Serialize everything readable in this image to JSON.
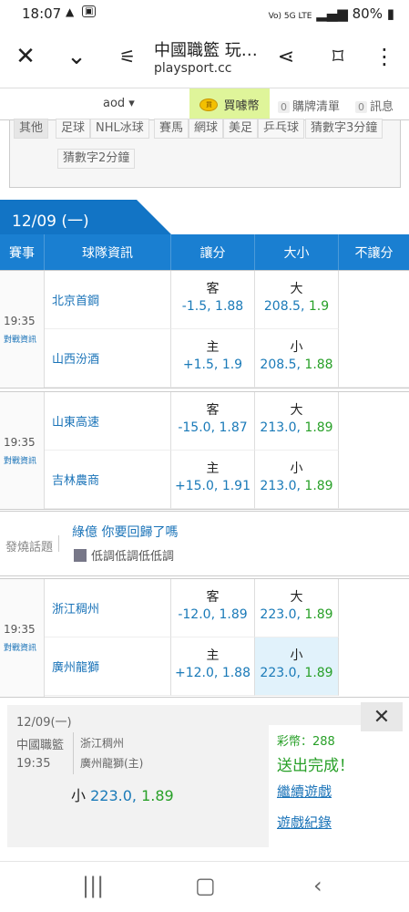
{
  "status": {
    "time": "18:07",
    "network": "Vo) 5G LTE",
    "battery": "80%"
  },
  "browser": {
    "title": "中國職籃 玩…",
    "url": "playsport.cc"
  },
  "subnav": {
    "user": "aod ▾",
    "coin": "買噱幣",
    "coin_icon": "買",
    "cart_count": "0",
    "cart": "購牌清單",
    "msg_count": "0",
    "msg": "訊息"
  },
  "filters": [
    "其他",
    "足球",
    "NHL冰球",
    "賽馬",
    "網球",
    "美足",
    "乒乓球",
    "猜數字3分鐘",
    "猜數字2分鐘"
  ],
  "date": "12/09 (一)",
  "headers": [
    "賽事",
    "球隊資訊",
    "讓分",
    "大小",
    "不讓分"
  ],
  "games": [
    {
      "time": "19:35",
      "info": "對戰資訊",
      "away": "北京首鋼",
      "home": "山西汾酒",
      "spread_away": {
        "label": "客",
        "line": "-1.5,",
        "price": "1.88"
      },
      "spread_home": {
        "label": "主",
        "line": "+1.5,",
        "price": "1.9"
      },
      "total_over": {
        "label": "大",
        "line": "208.5,",
        "price": "1.9"
      },
      "total_under": {
        "label": "小",
        "line": "208.5,",
        "price": "1.88"
      }
    },
    {
      "time": "19:35",
      "info": "對戰資訊",
      "away": "山東高速",
      "home": "吉林農商",
      "spread_away": {
        "label": "客",
        "line": "-15.0,",
        "price": "1.87"
      },
      "spread_home": {
        "label": "主",
        "line": "+15.0,",
        "price": "1.91"
      },
      "total_over": {
        "label": "大",
        "line": "213.0,",
        "price": "1.89"
      },
      "total_under": {
        "label": "小",
        "line": "213.0,",
        "price": "1.89"
      }
    },
    {
      "time": "19:35",
      "info": "對戰資訊",
      "away": "浙江稠州",
      "home": "廣州龍獅",
      "spread_away": {
        "label": "客",
        "line": "-12.0,",
        "price": "1.89"
      },
      "spread_home": {
        "label": "主",
        "line": "+12.0,",
        "price": "1.88"
      },
      "total_over": {
        "label": "大",
        "line": "223.0,",
        "price": "1.89"
      },
      "total_under": {
        "label": "小",
        "line": "223.0,",
        "price": "1.89"
      }
    }
  ],
  "forum": {
    "label": "發燒話題",
    "title": "綠億 你要回歸了嗎",
    "user": "低調低調低低調"
  },
  "popup": {
    "date": "12/09(一)",
    "league": "中國職籃",
    "time": "19:35",
    "team1": "浙江稠州",
    "team2": "廣州龍獅(主)",
    "pick_label": "小",
    "pick_line": "223.0,",
    "pick_price": "1.89",
    "coins": "彩幣：288",
    "done": "送出完成！",
    "continue": "繼續遊戲",
    "record": "遊戲紀錄",
    "close": "✕"
  }
}
